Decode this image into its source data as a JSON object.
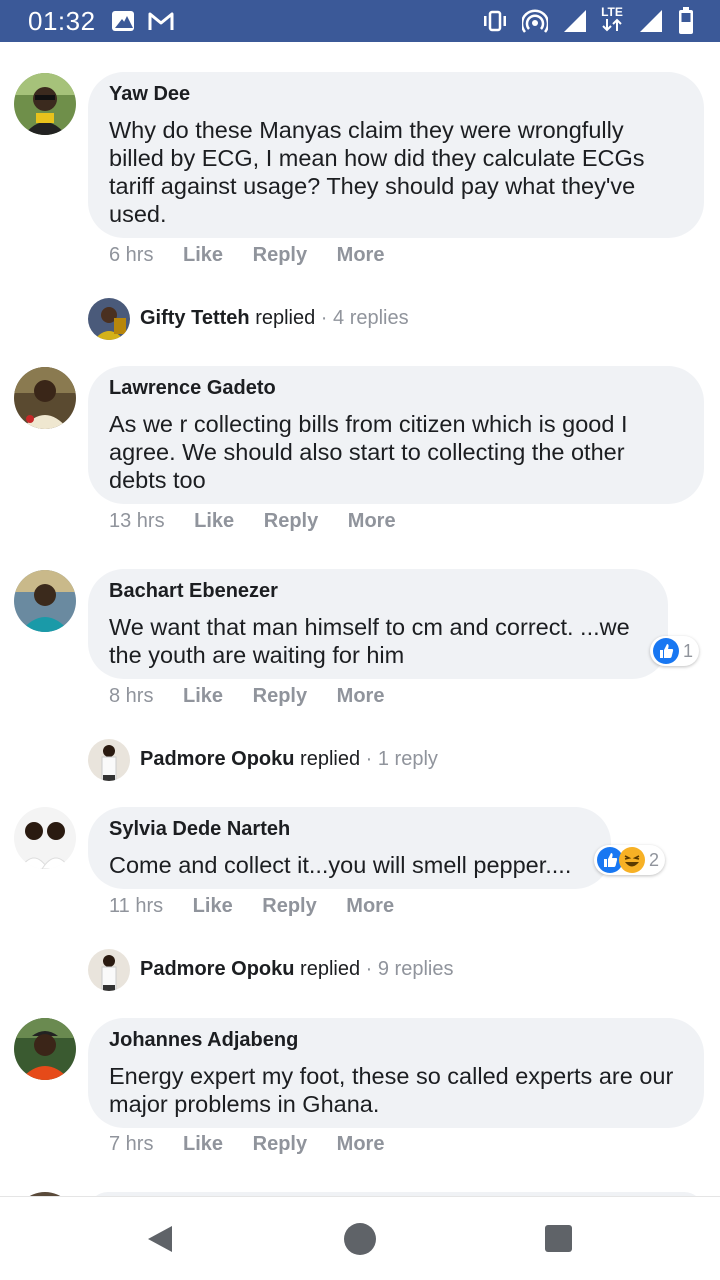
{
  "status_bar": {
    "time": "01:32",
    "network": "LTE",
    "icons": [
      "gallery-icon",
      "gmail-icon",
      "vibrate-icon",
      "hotspot-icon",
      "signal-icon",
      "lte-icon",
      "signal-icon",
      "battery-icon"
    ],
    "color": "#3b5998"
  },
  "comments": [
    {
      "author": "Yaw Dee",
      "text": "Why do these Manyas claim they were wrongfully billed by ECG, I mean how did they calculate ECGs tariff against usage? They should pay what they've used.",
      "time": "6 hrs",
      "like": "Like",
      "reply": "Reply",
      "more": "More",
      "replies": {
        "name": "Gifty Tetteh",
        "replied": "replied",
        "count": " · 4 replies"
      }
    },
    {
      "author": "Lawrence Gadeto",
      "text": "As we r collecting bills from citizen which is good I agree. We should also start to collecting the other debts too",
      "time": "13 hrs",
      "like": "Like",
      "reply": "Reply",
      "more": "More"
    },
    {
      "author": "Bachart Ebenezer",
      "text": "We want that man himself to cm and correct. ...we the youth are waiting for him",
      "time": "8 hrs",
      "like": "Like",
      "reply": "Reply",
      "more": "More",
      "reactions": {
        "count": "1"
      },
      "replies": {
        "name": "Padmore Opoku",
        "replied": "replied",
        "count": " · 1 reply"
      }
    },
    {
      "author": "Sylvia Dede Narteh",
      "text": "Come and collect it...you will smell pepper....",
      "time": "11 hrs",
      "like": "Like",
      "reply": "Reply",
      "more": "More",
      "reactions": {
        "count": "2"
      },
      "replies": {
        "name": "Padmore Opoku",
        "replied": "replied",
        "count": " · 9 replies"
      }
    },
    {
      "author": "Johannes Adjabeng",
      "text": "Energy expert my foot, these so called experts are our major problems in Ghana.",
      "time": "7 hrs",
      "like": "Like",
      "reply": "Reply",
      "more": "More"
    }
  ],
  "nav_bar": {
    "icons": [
      "back-icon",
      "home-icon",
      "recents-icon"
    ]
  },
  "colors": {
    "bubble": "#f0f2f5",
    "meta": "#90949c",
    "like_blue": "#1877f2"
  }
}
